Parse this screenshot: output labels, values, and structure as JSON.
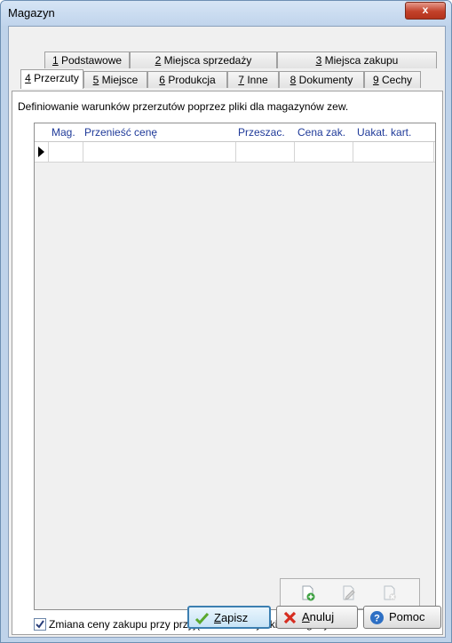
{
  "window": {
    "title": "Magazyn",
    "close_label": "x"
  },
  "tabs_row1": [
    {
      "hotkey": "1",
      "label": " Podstawowe"
    },
    {
      "hotkey": "2",
      "label": " Miejsca sprzedaży"
    },
    {
      "hotkey": "3",
      "label": " Miejsca zakupu"
    }
  ],
  "tabs_row2": [
    {
      "hotkey": "4",
      "label": " Przerzuty"
    },
    {
      "hotkey": "5",
      "label": " Miejsce"
    },
    {
      "hotkey": "6",
      "label": " Produkcja"
    },
    {
      "hotkey": "7",
      "label": " Inne"
    },
    {
      "hotkey": "8",
      "label": " Dokumenty"
    },
    {
      "hotkey": "9",
      "label": " Cechy"
    }
  ],
  "active_tab": "4 Przerzuty",
  "panel": {
    "description": "Definiowanie warunków przerzutów poprzez pliki dla magazynów zew.",
    "columns": [
      "Mag.",
      "Przenieść cenę",
      "Przeszac.",
      "Cena zak.",
      "Uakat. kart."
    ]
  },
  "toolbar": {
    "icons": [
      "add-document-icon",
      "edit-document-icon",
      "delete-document-icon"
    ]
  },
  "checkbox": {
    "label": "Zmiana ceny zakupu przy przyjęciach z wszystkich magazynów",
    "checked": true
  },
  "buttons": {
    "save": {
      "hotkey": "Z",
      "rest": "apisz"
    },
    "cancel": {
      "hotkey": "A",
      "rest": "nuluj"
    },
    "help": {
      "label": "Pomoc"
    }
  },
  "colors": {
    "header_text": "#1f3a99",
    "save_icon": "#5aa82e",
    "cancel_icon": "#d62d20",
    "help_icon": "#2d6fc4"
  }
}
